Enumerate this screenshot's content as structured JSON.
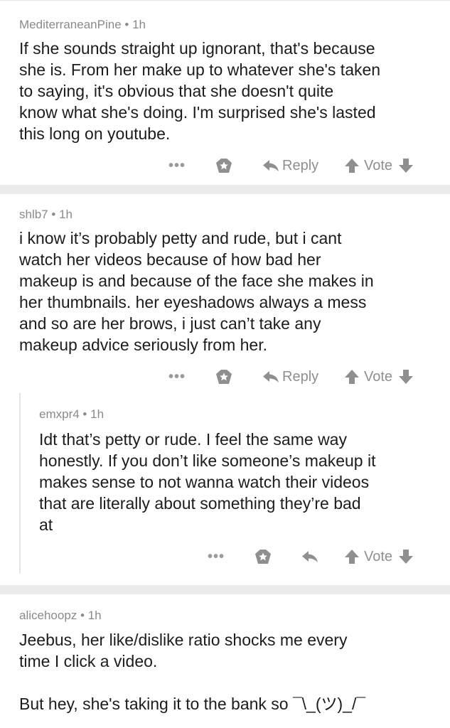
{
  "separator": "•",
  "comments": [
    {
      "author": "MediterraneanPine",
      "time": "1h",
      "text": "If she sounds straight up ignorant, that's because\nshe is. From her make up to whatever she's taken\nto saying, it's obvious that she doesn't quite\nknow what she's doing. I'm surprised she's lasted\nthis long on youtube.",
      "more": "•••",
      "reply_label": "Reply",
      "vote_label": "Vote"
    },
    {
      "author": "shlb7",
      "time": "1h",
      "text": "i know it’s probably petty and rude, but i cant\nwatch her videos because of how bad her\nmakeup is and because of the face she makes in\nher thumbnails. her eyeshadows always a mess\nand so are her brows, i just can’t take any\nmakeup advice seriously from her.",
      "more": "•••",
      "reply_label": "Reply",
      "vote_label": "Vote"
    },
    {
      "author": "emxpr4",
      "time": "1h",
      "text": "Idt that’s petty or rude. I feel the same way\nhonestly. If you don’t like someone’s makeup it\nmakes sense to not wanna watch their videos\nthat are literally about something they’re bad\nat",
      "more": "•••",
      "vote_label": "Vote"
    },
    {
      "author": "alicehoopz",
      "time": "1h",
      "text": "Jeebus, her like/dislike ratio shocks me every\ntime I click a video.\n\nBut hey, she's taking it to the bank so ¯\\_(ツ)_/¯"
    }
  ],
  "colors": {
    "divider": "#ececec",
    "meta": "#8a8a8a",
    "icon": "#8f8f8f"
  }
}
